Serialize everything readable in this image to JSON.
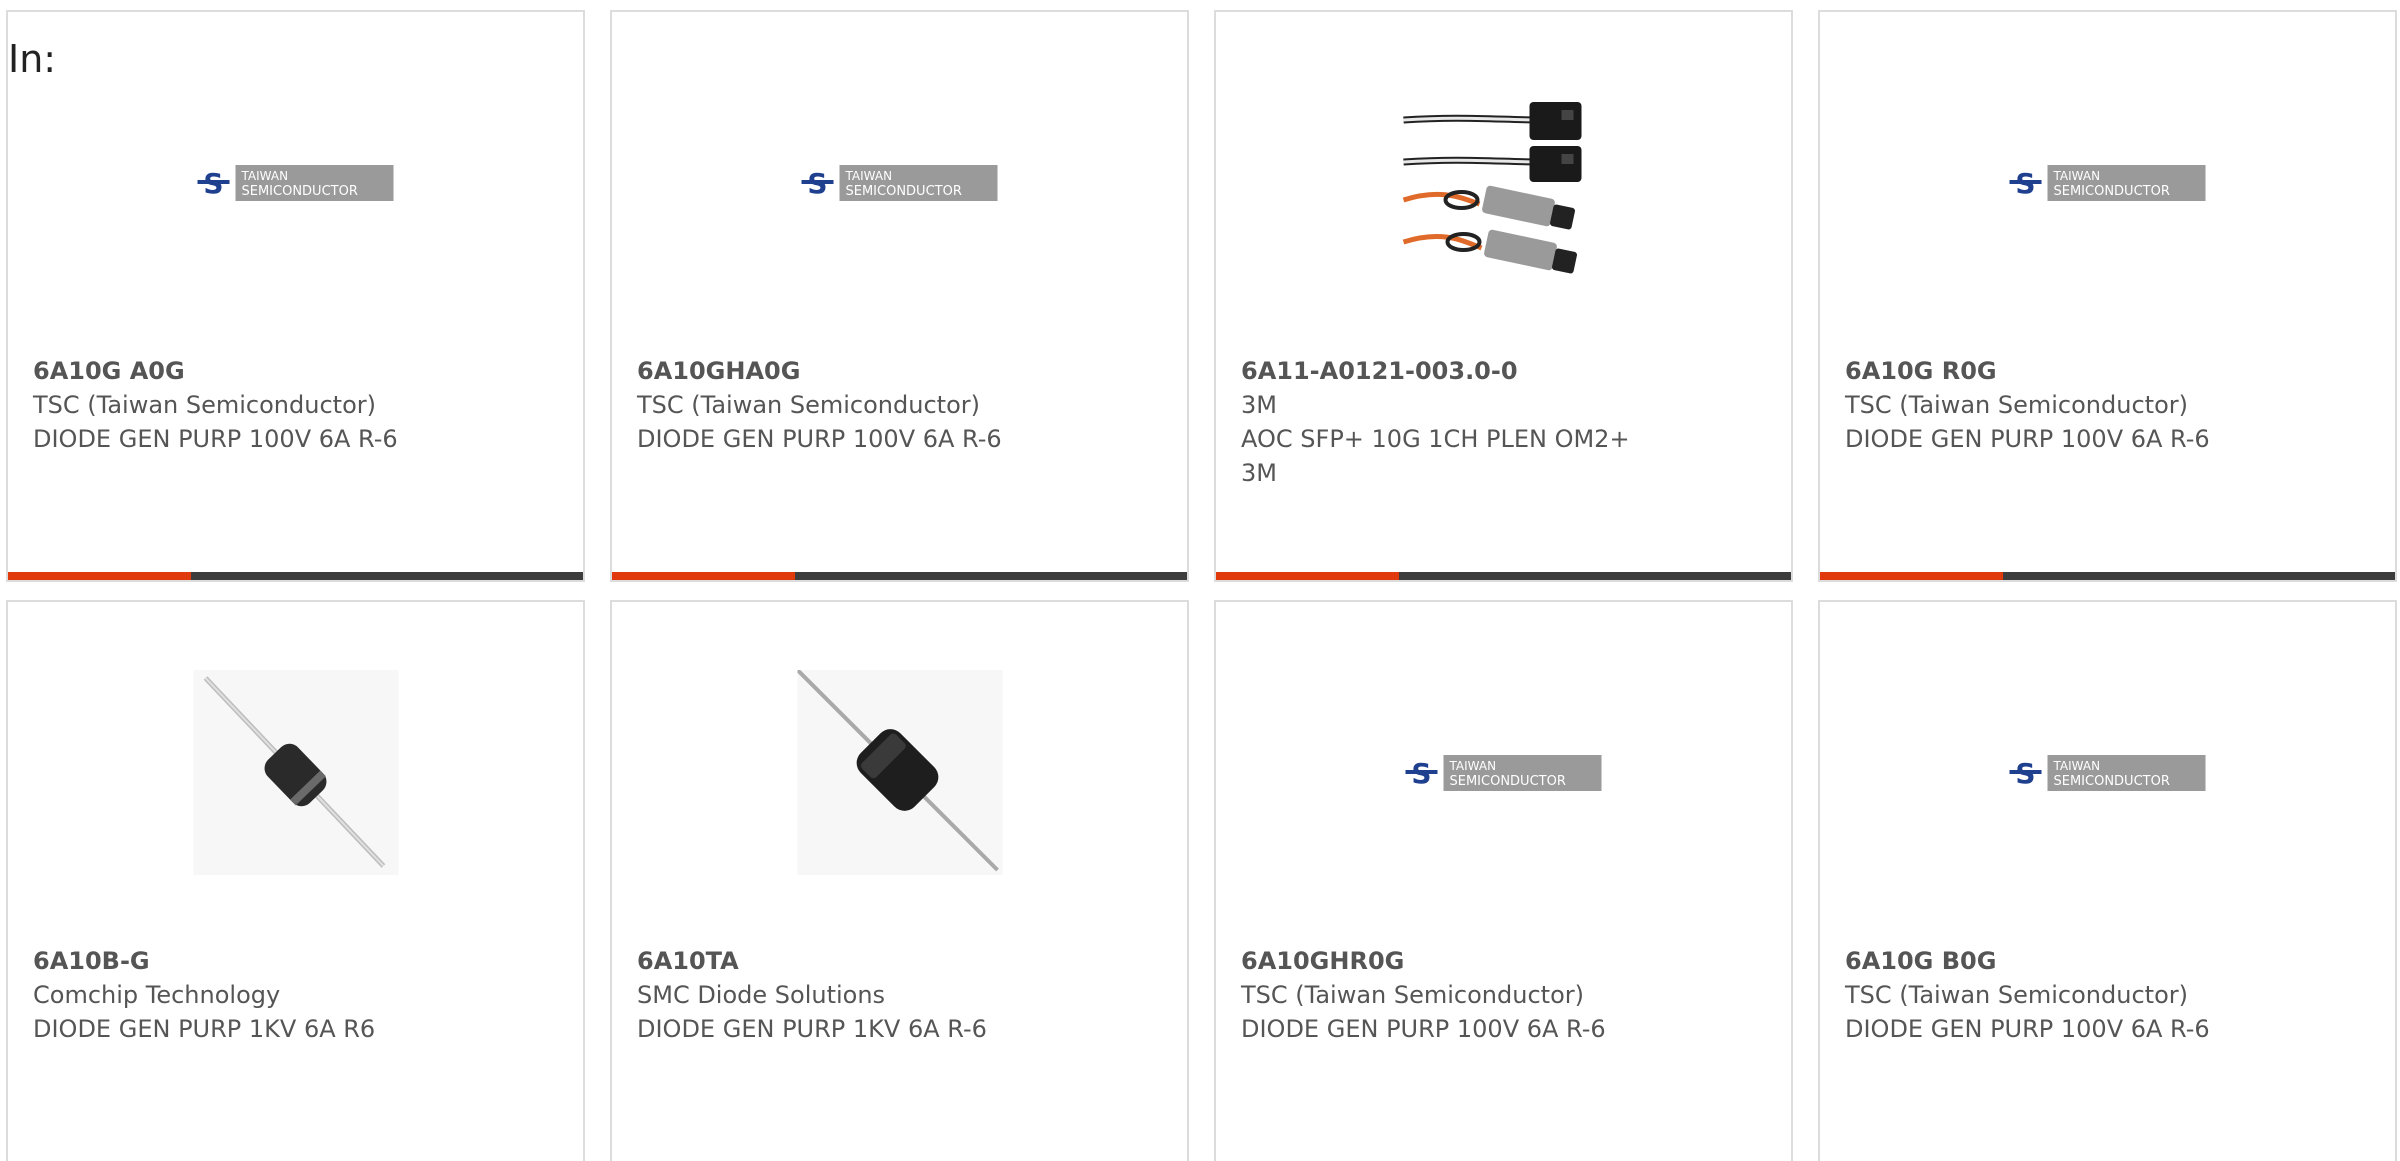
{
  "header": {
    "label": "In:"
  },
  "colors": {
    "accent": "#e03a0c",
    "bar_dark": "#3c3c3c",
    "text": "#555555",
    "logo_blue": "#1f3f8f",
    "logo_gray": "#9a9a9a"
  },
  "logo": {
    "line1": "TAIWAN",
    "line2": "SEMICONDUCTOR"
  },
  "products": [
    {
      "part": "6A10G A0G",
      "manufacturer": "TSC (Taiwan Semiconductor)",
      "description": "DIODE GEN PURP 100V 6A R-6",
      "extra": "",
      "image": "tsc-logo"
    },
    {
      "part": "6A10GHA0G",
      "manufacturer": "TSC (Taiwan Semiconductor)",
      "description": "DIODE GEN PURP 100V 6A R-6",
      "extra": "",
      "image": "tsc-logo"
    },
    {
      "part": "6A11-A0121-003.0-0",
      "manufacturer": "3M",
      "description": "AOC SFP+ 10G 1CH PLEN OM2+",
      "extra": "3M",
      "image": "sfp-cable"
    },
    {
      "part": "6A10G R0G",
      "manufacturer": "TSC (Taiwan Semiconductor)",
      "description": "DIODE GEN PURP 100V 6A R-6",
      "extra": "",
      "image": "tsc-logo"
    },
    {
      "part": "6A10B-G",
      "manufacturer": "Comchip Technology",
      "description": "DIODE GEN PURP 1KV 6A R6",
      "extra": "",
      "image": "diode"
    },
    {
      "part": "6A10TA",
      "manufacturer": "SMC Diode Solutions",
      "description": "DIODE GEN PURP 1KV 6A R-6",
      "extra": "",
      "image": "diode"
    },
    {
      "part": "6A10GHR0G",
      "manufacturer": "TSC (Taiwan Semiconductor)",
      "description": "DIODE GEN PURP 100V 6A R-6",
      "extra": "",
      "image": "tsc-logo"
    },
    {
      "part": "6A10G B0G",
      "manufacturer": "TSC (Taiwan Semiconductor)",
      "description": "DIODE GEN PURP 100V 6A R-6",
      "extra": "",
      "image": "tsc-logo"
    }
  ]
}
